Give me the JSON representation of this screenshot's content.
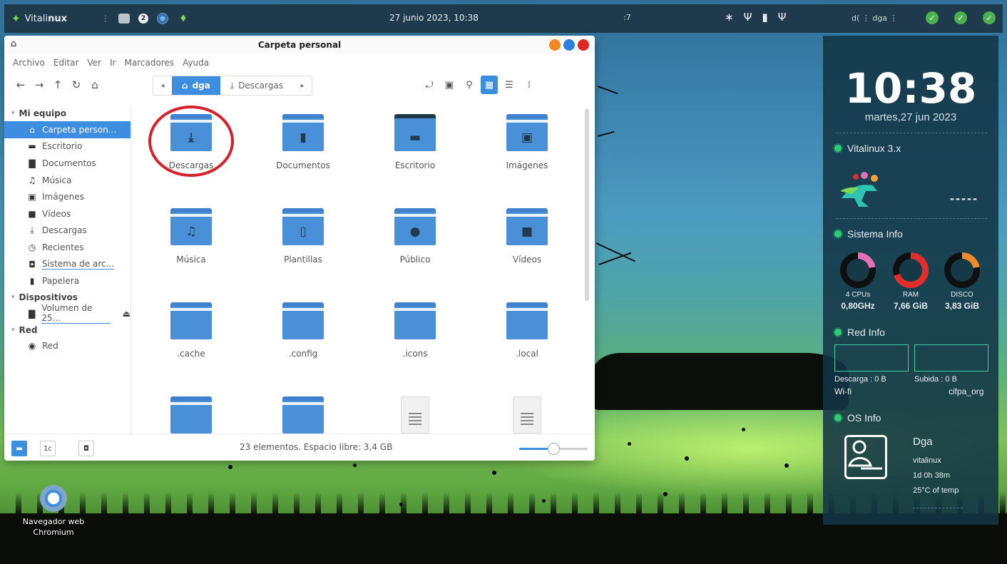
{
  "top_panel": {
    "brand_prefix": "Vitali",
    "brand_bold": "nux",
    "workspace_badge": "2",
    "datetime": "27 junio 2023, 10:38",
    "small_indicator": ":7",
    "user_text": "d( ⋮ dga ⋮",
    "tray_icons": [
      "bluetooth-icon",
      "usb-icon",
      "battery-icon",
      "usb-icon"
    ]
  },
  "window": {
    "title": "Carpeta personal",
    "menu": [
      "Archivo",
      "Editar",
      "Ver",
      "Ir",
      "Marcadores",
      "Ayuda"
    ],
    "breadcrumbs": [
      {
        "label": "dga",
        "icon": "⌂",
        "active": true
      },
      {
        "label": "Descargas",
        "icon": "⤓",
        "active": false
      }
    ],
    "sidebar": {
      "sections": [
        {
          "title": "Mi equipo",
          "items": [
            {
              "label": "Carpeta person...",
              "icon": "⌂",
              "selected": true
            },
            {
              "label": "Escritorio",
              "icon": "▬"
            },
            {
              "label": "Documentos",
              "icon": "▇"
            },
            {
              "label": "Música",
              "icon": "♫"
            },
            {
              "label": "Imágenes",
              "icon": "▣"
            },
            {
              "label": "Vídeos",
              "icon": "■"
            },
            {
              "label": "Descargas",
              "icon": "⤓"
            },
            {
              "label": "Recientes",
              "icon": "◷"
            },
            {
              "label": "Sistema de arc...",
              "icon": "◘"
            },
            {
              "label": "Papelera",
              "icon": "▮"
            }
          ]
        },
        {
          "title": "Dispositivos",
          "items": [
            {
              "label": "Volumen de 25...",
              "icon": "▇"
            }
          ]
        },
        {
          "title": "Red",
          "items": [
            {
              "label": "Red",
              "icon": "◉"
            }
          ]
        }
      ]
    },
    "files": [
      {
        "name": "Descargas",
        "type": "folder",
        "glyph": "⤓"
      },
      {
        "name": "Documentos",
        "type": "folder",
        "glyph": "▮"
      },
      {
        "name": "Escritorio",
        "type": "folder-dark",
        "glyph": "▬"
      },
      {
        "name": "Imágenes",
        "type": "folder",
        "glyph": "▣"
      },
      {
        "name": "Música",
        "type": "folder",
        "glyph": "♫"
      },
      {
        "name": "Plantillas",
        "type": "folder",
        "glyph": "▯"
      },
      {
        "name": "Público",
        "type": "folder",
        "glyph": "●"
      },
      {
        "name": "Vídeos",
        "type": "folder",
        "glyph": "■"
      },
      {
        "name": ".cache",
        "type": "folder",
        "glyph": ""
      },
      {
        "name": ".config",
        "type": "folder",
        "glyph": ""
      },
      {
        "name": ".icons",
        "type": "folder",
        "glyph": ""
      },
      {
        "name": ".local",
        "type": "folder",
        "glyph": ""
      },
      {
        "name": "",
        "type": "folder",
        "glyph": ""
      },
      {
        "name": "",
        "type": "folder",
        "glyph": ""
      },
      {
        "name": "",
        "type": "document",
        "glyph": ""
      },
      {
        "name": "",
        "type": "document",
        "glyph": ""
      }
    ],
    "status_text": "23 elementos. Espacio libre: 3,4 GB",
    "status_buttons": [
      "",
      "1c",
      "◘"
    ],
    "zoom_level": 0.5
  },
  "desktop": {
    "icon_label_line1": "Navegador web",
    "icon_label_line2": "Chromium"
  },
  "conky": {
    "time": "10:38",
    "date": "martes,27 jun 2023",
    "distro": "Vitalinux 3.x",
    "placeholder": "-----",
    "system_title": "Sistema Info",
    "rings": [
      {
        "label": "4 CPUs",
        "value": "0,80GHz",
        "color": "#e76fb5"
      },
      {
        "label": "RAM",
        "value": "7,66 GiB",
        "color": "#e22d2d"
      },
      {
        "label": "DISCO",
        "value": "3,83 GiB",
        "color": "#f08a2a"
      }
    ],
    "net_title": "Red Info",
    "download": "Descarga : 0 B",
    "upload": "Subida : 0 B",
    "wifi_label": "Wi-fi",
    "wifi_name": "cifpa_org",
    "os_title": "OS Info",
    "user": "Dga",
    "host": "vitalinux",
    "uptime": "1d 0h 38m",
    "temp": "25°C of temp"
  }
}
